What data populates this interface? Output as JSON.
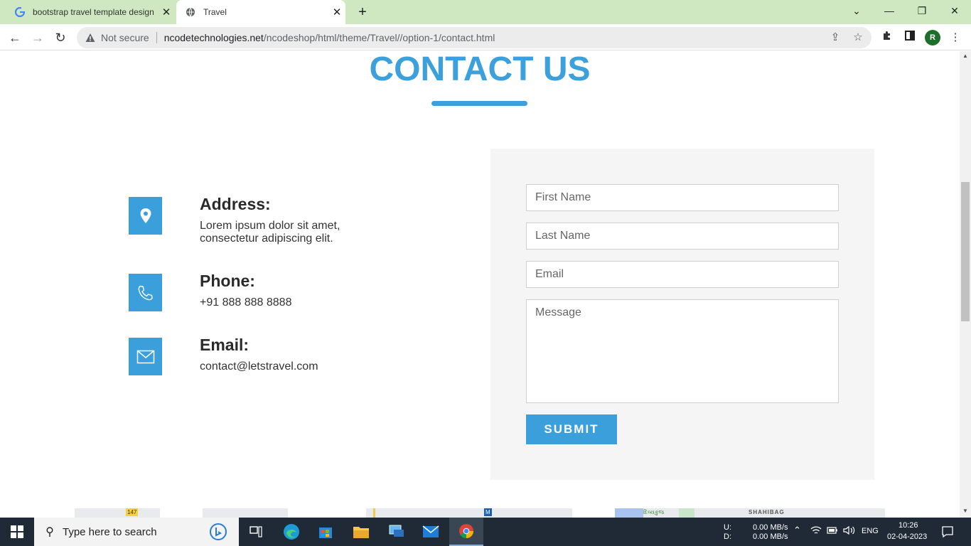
{
  "browser": {
    "tabs": [
      {
        "title": "bootstrap travel template design",
        "active": false
      },
      {
        "title": "Travel",
        "active": true
      }
    ],
    "new_tab": "+",
    "window_controls": {
      "minimize": "—",
      "restore": "❐",
      "close": "✕",
      "tab_search": "⌄"
    },
    "address": {
      "security": "Not secure",
      "host": "ncodetechnologies.net",
      "path": "/ncodeshop/html/theme/Travel//option-1/contact.html"
    },
    "profile_initial": "R"
  },
  "page": {
    "heading": "CONTACT US",
    "accent_color": "#3ba0dc",
    "contact_items": [
      {
        "icon": "map-pin-icon",
        "title": "Address:",
        "lines": [
          "Lorem ipsum dolor sit amet,",
          "consectetur adipiscing elit."
        ]
      },
      {
        "icon": "phone-icon",
        "title": "Phone:",
        "lines": [
          "+91 888 888 8888"
        ]
      },
      {
        "icon": "envelope-icon",
        "title": "Email:",
        "lines": [
          "contact@letstravel.com"
        ]
      }
    ],
    "form": {
      "first_name_placeholder": "First Name",
      "last_name_placeholder": "Last Name",
      "email_placeholder": "Email",
      "message_placeholder": "Message",
      "submit_label": "SUBMIT"
    },
    "map_labels": {
      "route": "147",
      "metro": "M",
      "place_gu": "દિવ્યકુંજ",
      "area": "SHAHIBAG"
    }
  },
  "taskbar": {
    "search_placeholder": "Type here to search",
    "network": {
      "up_label": "U:",
      "down_label": "D:",
      "up": "0.00 MB/s",
      "down": "0.00 MB/s"
    },
    "language": "ENG",
    "time": "10:26",
    "date": "02-04-2023",
    "apps": [
      "task-view-icon",
      "edge-icon",
      "store-icon",
      "file-explorer-icon",
      "remote-desktop-icon",
      "mail-icon",
      "chrome-icon"
    ]
  }
}
